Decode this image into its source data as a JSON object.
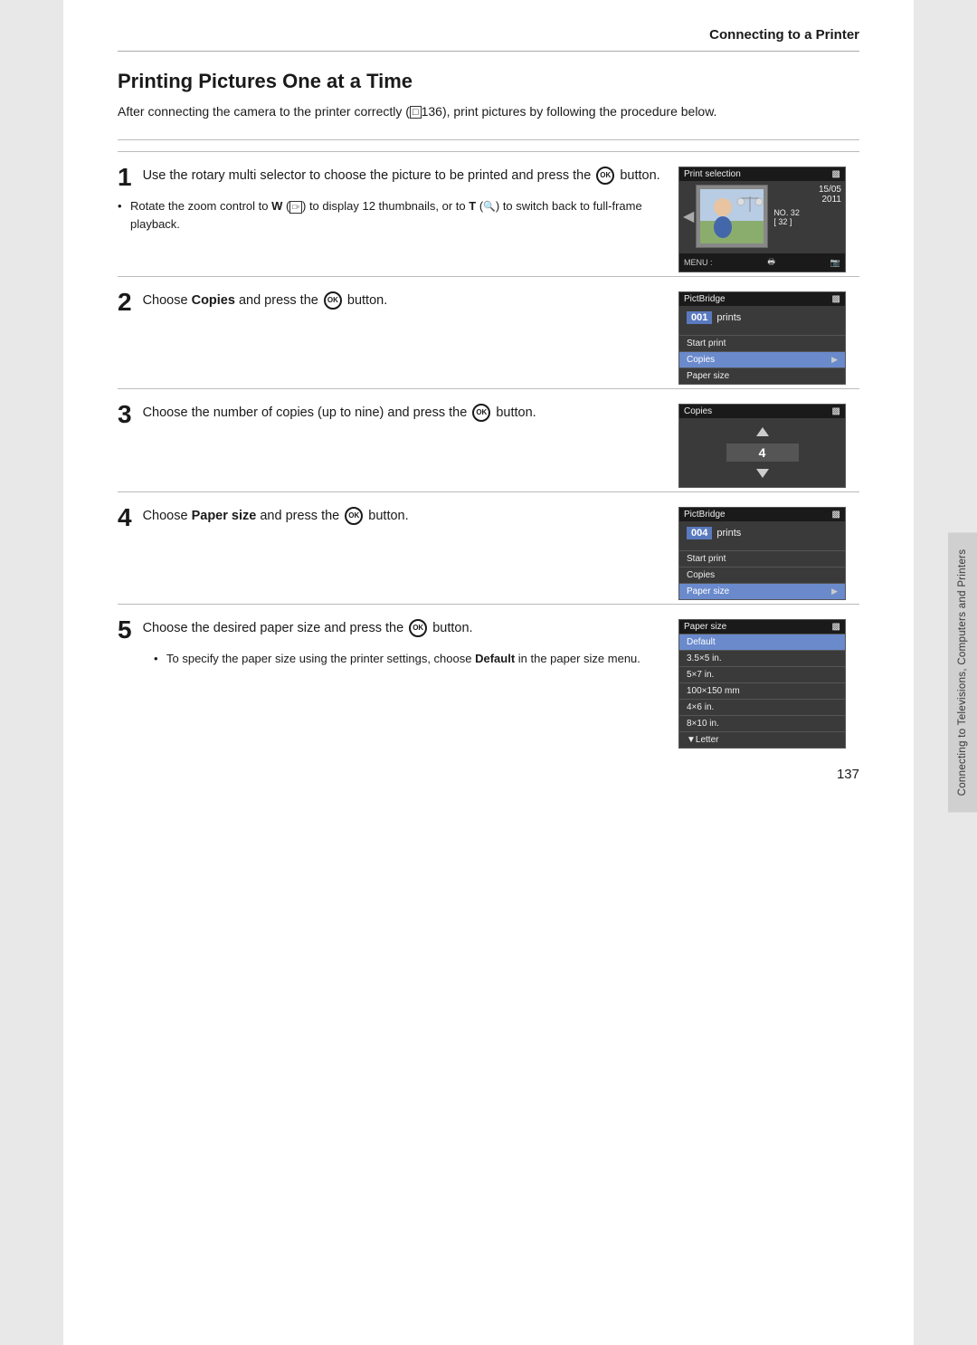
{
  "header": {
    "title": "Connecting to a Printer"
  },
  "page_title": "Printing Pictures One at a Time",
  "intro": "After connecting the camera to the printer correctly ( 136), print pictures by following the procedure below.",
  "steps": [
    {
      "number": "1",
      "text": "Use the rotary multi selector to choose the picture to be printed and press the Ⓢ button.",
      "bullet": "Rotate the zoom control to W (▣) to display 12 thumbnails, or to T (🔍) to switch back to full-frame playback.",
      "screen": "print_selection"
    },
    {
      "number": "2",
      "text": "Choose Copies and press the Ⓢ button.",
      "screen": "pictbridge_copies"
    },
    {
      "number": "3",
      "text": "Choose the number of copies (up to nine) and press the Ⓢ button.",
      "screen": "copies_number"
    },
    {
      "number": "4",
      "text": "Choose Paper size and press the Ⓢ button.",
      "screen": "pictbridge_paper"
    },
    {
      "number": "5",
      "text": "Choose the desired paper size and press the Ⓢ button.",
      "bullet": "To specify the paper size using the printer settings, choose Default in the paper size menu.",
      "screen": "paper_size"
    }
  ],
  "screens": {
    "print_selection": {
      "title": "Print selection",
      "date": "15/05\n2011",
      "no_label": "NO. 32",
      "no_value": "[ 32 ]"
    },
    "pictbridge_copies": {
      "title": "PictBridge",
      "prints_value": "001",
      "prints_label": "prints",
      "menu_items": [
        "Start print",
        "Copies",
        "Paper size"
      ],
      "selected": "Copies"
    },
    "copies_number": {
      "title": "Copies",
      "value": "4"
    },
    "pictbridge_paper": {
      "title": "PictBridge",
      "prints_value": "004",
      "prints_label": "prints",
      "menu_items": [
        "Start print",
        "Copies",
        "Paper size"
      ],
      "selected": "Paper size"
    },
    "paper_size": {
      "title": "Paper size",
      "items": [
        "Default",
        "3.5×5 in.",
        "5×7 in.",
        "100×150 mm",
        "4×6 in.",
        "8×10 in.",
        "▼Letter"
      ],
      "selected": "Default"
    }
  },
  "sidebar_label": "Connecting to Televisions, Computers and Printers",
  "page_number": "137"
}
